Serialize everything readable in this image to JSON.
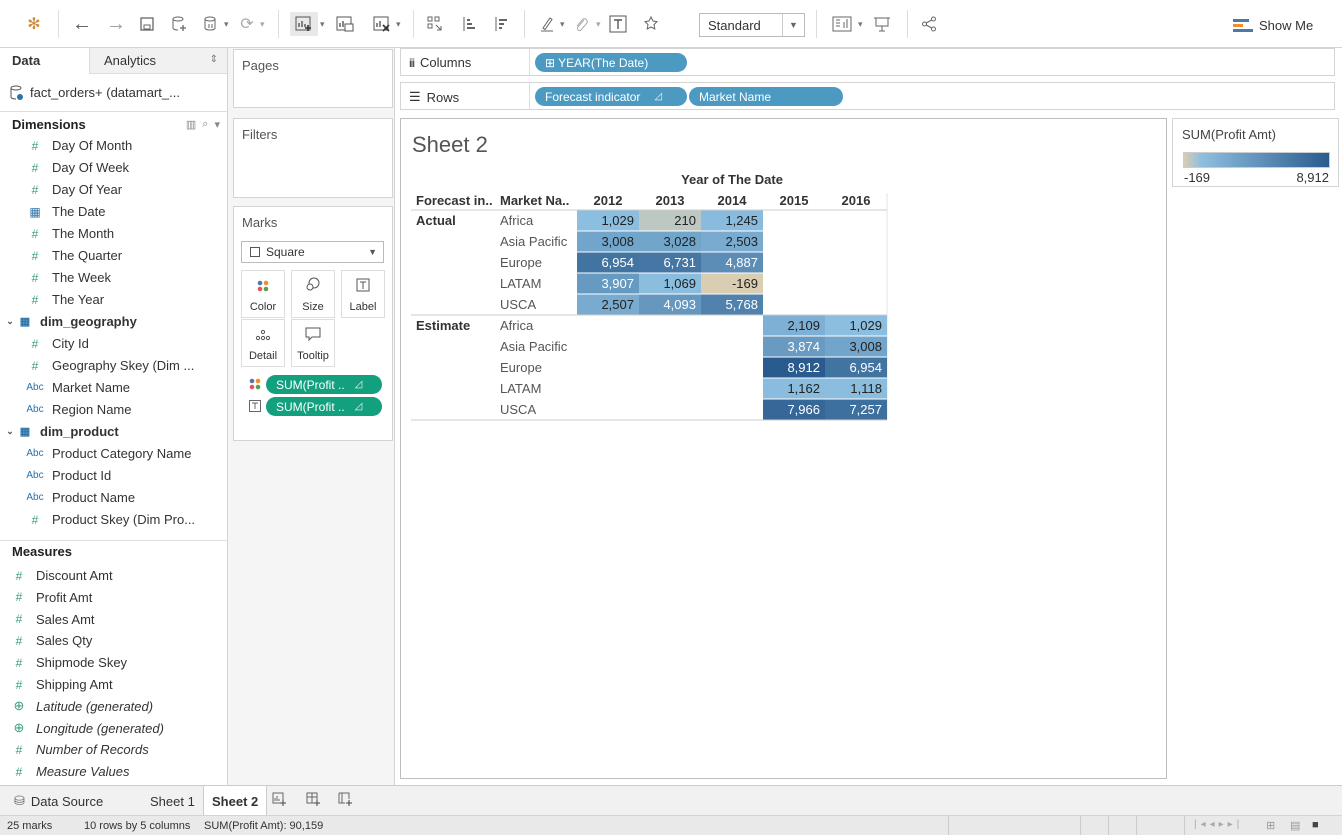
{
  "toolbar": {
    "style_select": "Standard",
    "show_me_label": "Show Me",
    "show_me_colors": [
      "#4e79a7",
      "#f28e2b",
      "#4e79a7"
    ]
  },
  "data_pane": {
    "tab_data": "Data",
    "tab_analytics": "Analytics",
    "datasource": "fact_orders+ (datamart_...",
    "dimensions_title": "Dimensions",
    "measures_title": "Measures",
    "dimension_fields": [
      {
        "label": "Day Of Month",
        "icon": "hash-icon"
      },
      {
        "label": "Day Of Week",
        "icon": "hash-icon"
      },
      {
        "label": "Day Of Year",
        "icon": "hash-icon"
      },
      {
        "label": "The Date",
        "icon": "calendar-icon"
      },
      {
        "label": "The Month",
        "icon": "hash-icon"
      },
      {
        "label": "The Quarter",
        "icon": "hash-icon"
      },
      {
        "label": "The Week",
        "icon": "hash-icon"
      },
      {
        "label": "The Year",
        "icon": "hash-icon"
      }
    ],
    "folder_geography": "dim_geography",
    "geography_fields": [
      {
        "label": "City Id",
        "icon": "hash-icon"
      },
      {
        "label": "Geography Skey (Dim ...",
        "icon": "hash-icon"
      },
      {
        "label": "Market Name",
        "icon": "abc-icon"
      },
      {
        "label": "Region Name",
        "icon": "abc-icon"
      }
    ],
    "folder_product": "dim_product",
    "product_fields": [
      {
        "label": "Product Category Name",
        "icon": "abc-icon"
      },
      {
        "label": "Product Id",
        "icon": "abc-icon"
      },
      {
        "label": "Product Name",
        "icon": "abc-icon"
      },
      {
        "label": "Product Skey (Dim Pro...",
        "icon": "hash-icon"
      }
    ],
    "measure_fields": [
      {
        "label": "Discount Amt",
        "icon": "hash-icon",
        "italic": false
      },
      {
        "label": "Profit Amt",
        "icon": "hash-icon",
        "italic": false
      },
      {
        "label": "Sales Amt",
        "icon": "hash-icon",
        "italic": false
      },
      {
        "label": "Sales Qty",
        "icon": "hash-icon",
        "italic": false
      },
      {
        "label": "Shipmode Skey",
        "icon": "hash-icon",
        "italic": false
      },
      {
        "label": "Shipping Amt",
        "icon": "hash-icon",
        "italic": false
      },
      {
        "label": "Latitude (generated)",
        "icon": "globe-icon",
        "italic": true
      },
      {
        "label": "Longitude (generated)",
        "icon": "globe-icon",
        "italic": true
      },
      {
        "label": "Number of Records",
        "icon": "hash-icon",
        "italic": true
      },
      {
        "label": "Measure Values",
        "icon": "hash-icon",
        "italic": true
      }
    ]
  },
  "cards": {
    "pages": "Pages",
    "filters": "Filters",
    "marks": "Marks",
    "mark_type": "Square",
    "btn_color": "Color",
    "btn_size": "Size",
    "btn_label": "Label",
    "btn_detail": "Detail",
    "btn_tooltip": "Tooltip",
    "pill_color": "SUM(Profit ..",
    "pill_label": "SUM(Profit .."
  },
  "shelves": {
    "columns_label": "Columns",
    "rows_label": "Rows",
    "columns_pills": [
      "⊞ YEAR(The Date)"
    ],
    "rows_pills": [
      "Forecast indicator",
      "Market Name"
    ]
  },
  "view": {
    "sheet_title": "Sheet 2"
  },
  "chart_data": {
    "type": "table",
    "column_header_title": "Year of The Date",
    "row_header_1": "Forecast in..",
    "row_header_2": "Market Na..",
    "columns": [
      "2012",
      "2013",
      "2014",
      "2015",
      "2016"
    ],
    "groups": [
      {
        "name": "Actual",
        "rows": [
          {
            "market": "Africa",
            "values": [
              "1,029",
              "210",
              "1,245",
              null,
              null
            ]
          },
          {
            "market": "Asia Pacific",
            "values": [
              "3,008",
              "3,028",
              "2,503",
              null,
              null
            ]
          },
          {
            "market": "Europe",
            "values": [
              "6,954",
              "6,731",
              "4,887",
              null,
              null
            ]
          },
          {
            "market": "LATAM",
            "values": [
              "3,907",
              "1,069",
              "-169",
              null,
              null
            ]
          },
          {
            "market": "USCA",
            "values": [
              "2,507",
              "4,093",
              "5,768",
              null,
              null
            ]
          }
        ]
      },
      {
        "name": "Estimate",
        "rows": [
          {
            "market": "Africa",
            "values": [
              null,
              null,
              null,
              "2,109",
              "1,029"
            ]
          },
          {
            "market": "Asia Pacific",
            "values": [
              null,
              null,
              null,
              "3,874",
              "3,008"
            ]
          },
          {
            "market": "Europe",
            "values": [
              null,
              null,
              null,
              "8,912",
              "6,954"
            ]
          },
          {
            "market": "LATAM",
            "values": [
              null,
              null,
              null,
              "1,162",
              "1,118"
            ]
          },
          {
            "market": "USCA",
            "values": [
              null,
              null,
              null,
              "7,966",
              "7,257"
            ]
          }
        ]
      }
    ],
    "color_min": -169,
    "color_max": 8912
  },
  "legend": {
    "title": "SUM(Profit Amt)",
    "min_label": "-169",
    "max_label": "8,912",
    "low_color": "#d9cdb2",
    "mid_color": "#8cbfe0",
    "high_color": "#2a5b8e"
  },
  "tabs": {
    "data_source": "Data Source",
    "sheet1": "Sheet 1",
    "sheet2": "Sheet 2"
  },
  "status": {
    "marks": "25 marks",
    "dims": "10 rows by 5 columns",
    "sum": "SUM(Profit Amt): 90,159"
  }
}
